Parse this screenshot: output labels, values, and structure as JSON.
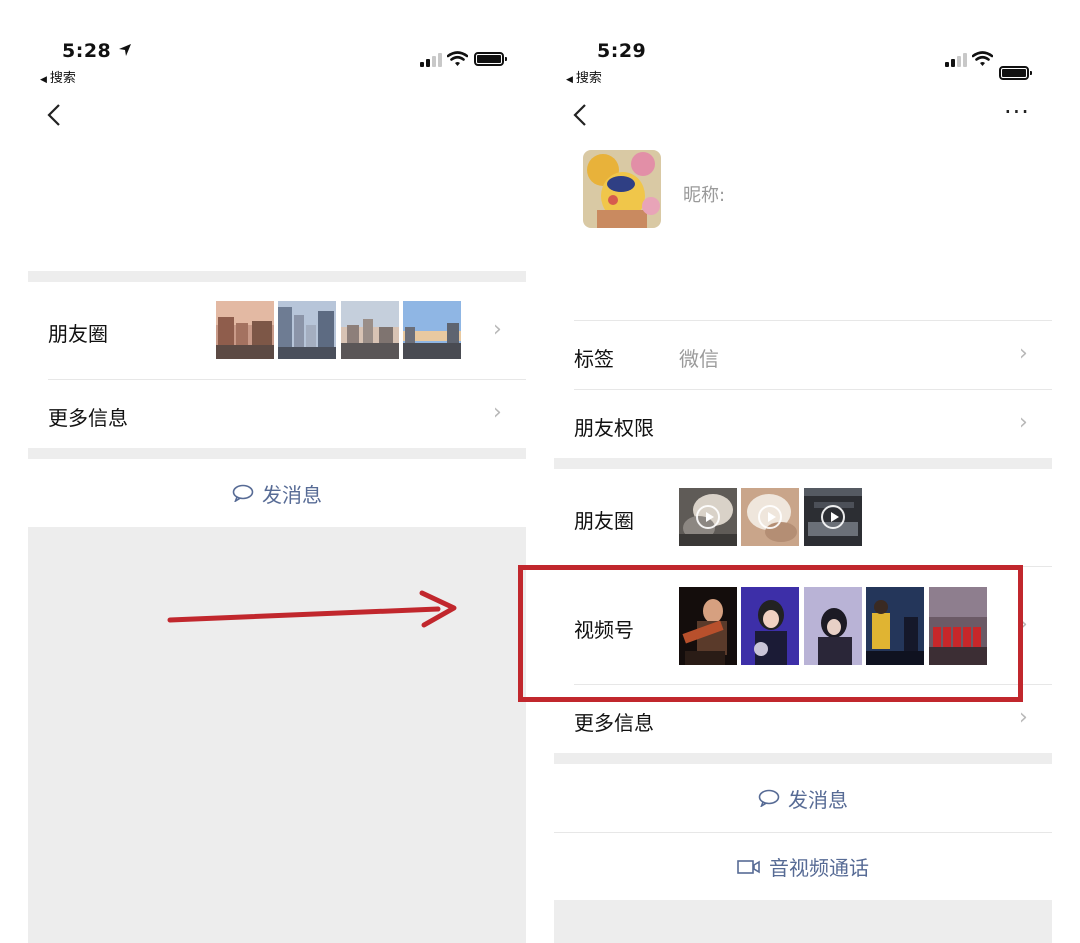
{
  "left": {
    "status": {
      "time": "5:28",
      "back_app": "搜索"
    },
    "rows": {
      "moments_label": "朋友圈",
      "more_info_label": "更多信息"
    },
    "send_message": "发消息"
  },
  "right": {
    "status": {
      "time": "5:29",
      "back_app": "搜索"
    },
    "profile": {
      "nickname_label": "昵称:"
    },
    "rows": {
      "tags_label": "标签",
      "tags_value": "微信",
      "permissions_label": "朋友权限",
      "moments_label": "朋友圈",
      "channels_label": "视频号",
      "more_info_label": "更多信息"
    },
    "send_message": "发消息",
    "video_call": "音视频通话"
  },
  "colors": {
    "annotation_red": "#c1272d",
    "link_blue": "#576b95",
    "gray_background": "#ededed"
  },
  "icons": [
    "location-arrow-icon",
    "signal-icon",
    "wifi-icon",
    "battery-icon",
    "back-chevron-icon",
    "more-icon",
    "chevron-right-icon",
    "chat-bubble-icon",
    "video-camera-icon",
    "play-icon"
  ]
}
